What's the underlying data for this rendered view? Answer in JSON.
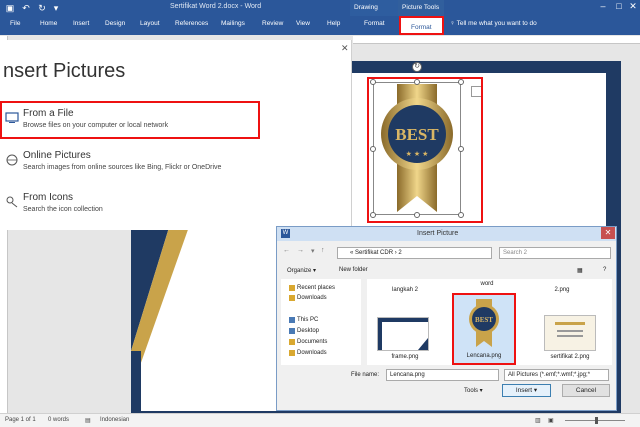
{
  "titlebar": {
    "title": "Sertifikat Word 2.docx  -  Word",
    "context_drawing": "Drawing Tools",
    "context_picture": "Picture Tools"
  },
  "tabs": {
    "file": "File",
    "home": "Home",
    "insert": "Insert",
    "design": "Design",
    "layout": "Layout",
    "references": "References",
    "mailings": "Mailings",
    "review": "Review",
    "view": "View",
    "help": "Help",
    "format_drawing": "Format",
    "format_picture": "Format",
    "tell_me": "Tell me what you want to do"
  },
  "insert_pictures": {
    "title": "nsert Pictures",
    "options": [
      {
        "title": "From a File",
        "desc": "Browse files on your computer or local network"
      },
      {
        "title": "Online Pictures",
        "desc": "Search images from online sources like Bing, Flickr or OneDrive"
      },
      {
        "title": "From Icons",
        "desc": "Search the icon collection"
      }
    ]
  },
  "badge": {
    "text": "BEST",
    "colors": {
      "navy": "#1f3a63",
      "gold": "#c9a34a"
    }
  },
  "dialog": {
    "title": "Insert Picture",
    "address": [
      "Sertifikat CDR",
      "2"
    ],
    "search_placeholder": "Search 2",
    "organize": "Organize ▾",
    "new_folder": "New folder",
    "nav_items": [
      "Recent places",
      "Downloads",
      "This PC",
      "Desktop",
      "Documents",
      "Downloads"
    ],
    "files": [
      "langkah 2",
      "word",
      "2.png",
      "frame.png",
      "Lencana.png",
      "sertifikat 2.png"
    ],
    "file_name_label": "File name:",
    "file_name_value": "Lencana.png",
    "file_type": "All Pictures (*.emf;*.wmf;*.jpg;*",
    "tools_label": "Tools ▾",
    "insert_button": "Insert",
    "cancel_button": "Cancel"
  },
  "statusbar": {
    "page": "Page 1 of 1",
    "words": "0 words",
    "language": "Indonesian"
  },
  "colors": {
    "ribbon": "#2b579a",
    "highlight": "#ee1111"
  }
}
